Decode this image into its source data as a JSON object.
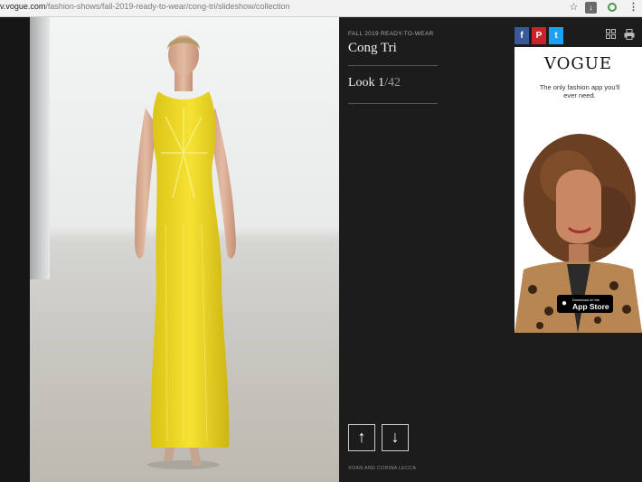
{
  "browser": {
    "url_host": "v.vogue.com",
    "url_path": "/fashion-shows/fall-2019-ready-to-wear/cong-tri/slideshow/collection",
    "icons": [
      "star-icon",
      "download-icon",
      "extension-icon",
      "menu-icon"
    ]
  },
  "gallery": {
    "season": "FALL 2019 READY-TO-WEAR",
    "designer": "Cong Tri",
    "look_label": "Look ",
    "look_current": "1",
    "look_total": "/42",
    "credit": "©DAN AND CORINA LECCA",
    "zoom_icon": "zoom-in-icon",
    "up_label": "↑",
    "down_label": "↓"
  },
  "social": {
    "facebook": "f",
    "pinterest": "P",
    "twitter": "t"
  },
  "ad": {
    "logo": "VOGUE",
    "tagline": "The only fashion app you'll ever need.",
    "badge_small": "Download on the",
    "badge_big": "App Store"
  },
  "colors": {
    "background": "#1a1a1a",
    "zoom": "#c0151b",
    "facebook": "#3b5998",
    "pinterest": "#c8232c",
    "twitter": "#1da1f2",
    "dress": "#f1dc2a"
  }
}
